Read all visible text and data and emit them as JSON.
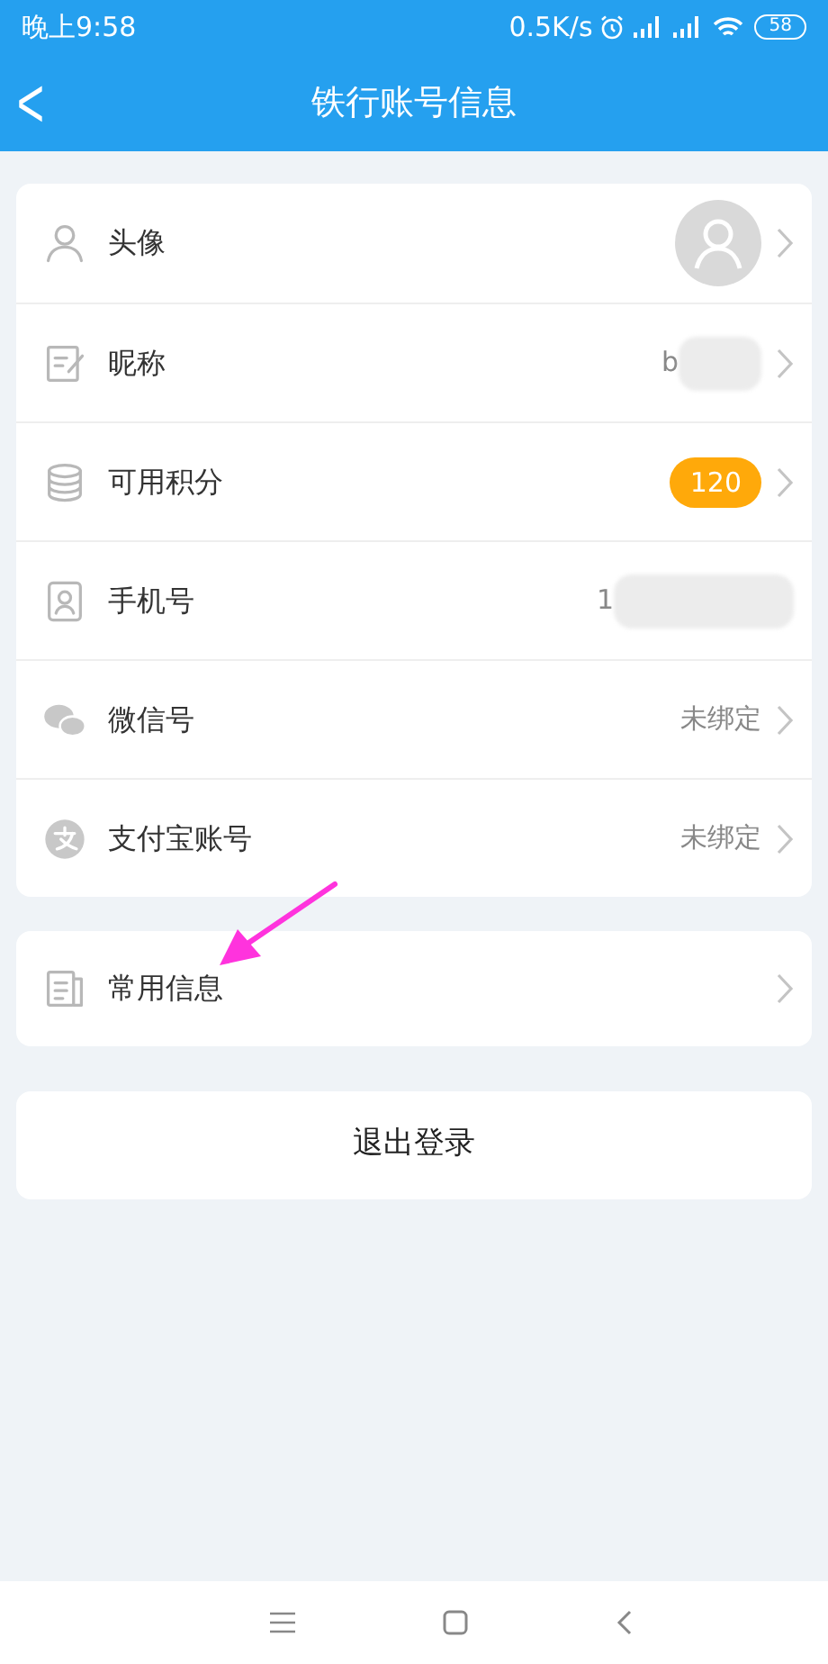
{
  "status_bar": {
    "time": "晚上9:58",
    "speed": "0.5K/s",
    "battery": "58"
  },
  "header": {
    "back": "<",
    "title": "铁行账号信息"
  },
  "account_rows": [
    {
      "label": "头像",
      "kind": "avatar"
    },
    {
      "label": "昵称",
      "kind": "value",
      "value": "b",
      "redacted": true
    },
    {
      "label": "可用积分",
      "kind": "badge",
      "value": "120"
    },
    {
      "label": "手机号",
      "kind": "value",
      "value": "1",
      "redacted": true,
      "chevron": false
    },
    {
      "label": "微信号",
      "kind": "value",
      "value": "未绑定",
      "redacted": false
    },
    {
      "label": "支付宝账号",
      "kind": "value",
      "value": "未绑定",
      "redacted": false
    }
  ],
  "info_row": {
    "label": "常用信息",
    "pointer_arrow": true
  },
  "logout_button": "退出登录"
}
